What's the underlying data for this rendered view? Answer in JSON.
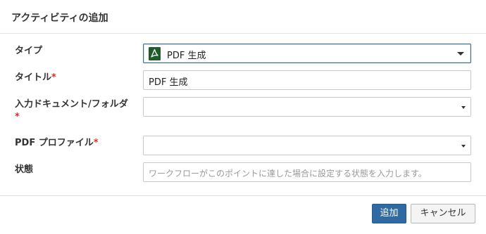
{
  "dialog": {
    "title": "アクティビティの追加"
  },
  "fields": {
    "type": {
      "label": "タイプ",
      "value": "PDF 生成",
      "icon": "pdf-icon"
    },
    "title": {
      "label": "タイトル",
      "required_mark": "*",
      "value": "PDF 生成"
    },
    "input_document": {
      "label": "入力ドキュメント/フォルダ",
      "required_mark": "*",
      "value": ""
    },
    "pdf_profile": {
      "label": "PDF プロファイル",
      "required_mark": "*",
      "value": ""
    },
    "state": {
      "label": "状態",
      "placeholder": "ワークフローがこのポイントに達した場合に設定する状態を入力します。"
    }
  },
  "buttons": {
    "add_label": "追加",
    "cancel_label": "キャンセル"
  },
  "colors": {
    "primary_button": "#2f6aa3",
    "required": "#d9302c",
    "pdf_icon": "#1e5c2b"
  }
}
